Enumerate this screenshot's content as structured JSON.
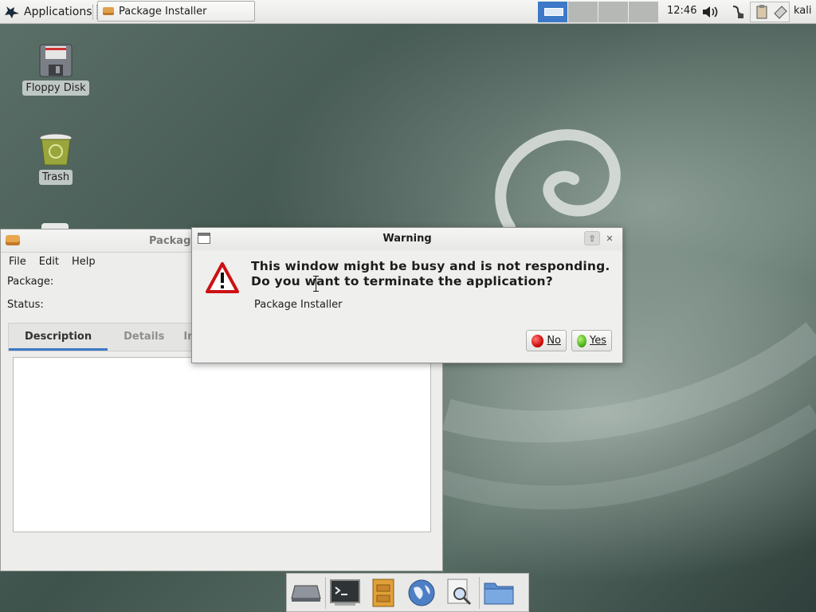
{
  "top_panel": {
    "applications_label": "Applications",
    "task_button_label": "Package Installer",
    "clock": "12:46",
    "user": "kali"
  },
  "desktop": {
    "icons": [
      {
        "label": "Floppy Disk",
        "icon": "floppy-disk-icon"
      },
      {
        "label": "Trash",
        "icon": "trash-icon"
      }
    ]
  },
  "package_window": {
    "title": "Package",
    "menu": [
      "File",
      "Edit",
      "Help"
    ],
    "package_label": "Package:",
    "status_label": "Status:",
    "tabs": [
      "Description",
      "Details",
      "In"
    ]
  },
  "warning_dialog": {
    "title": "Warning",
    "message_line1": "This window might be busy and is not responding.",
    "message_line2": "Do you want to terminate the application?",
    "app_name": "Package Installer",
    "no_label": "No",
    "yes_label": "Yes"
  },
  "dock": {
    "items": [
      "drive-icon",
      "terminal-icon",
      "file-cabinet-icon",
      "web-browser-icon",
      "search-icon",
      "folder-icon"
    ]
  },
  "colors": {
    "accent": "#3d79c8",
    "no_button": "#d10c0c",
    "yes_button": "#4eb81c",
    "warning_red": "#cc1111"
  }
}
